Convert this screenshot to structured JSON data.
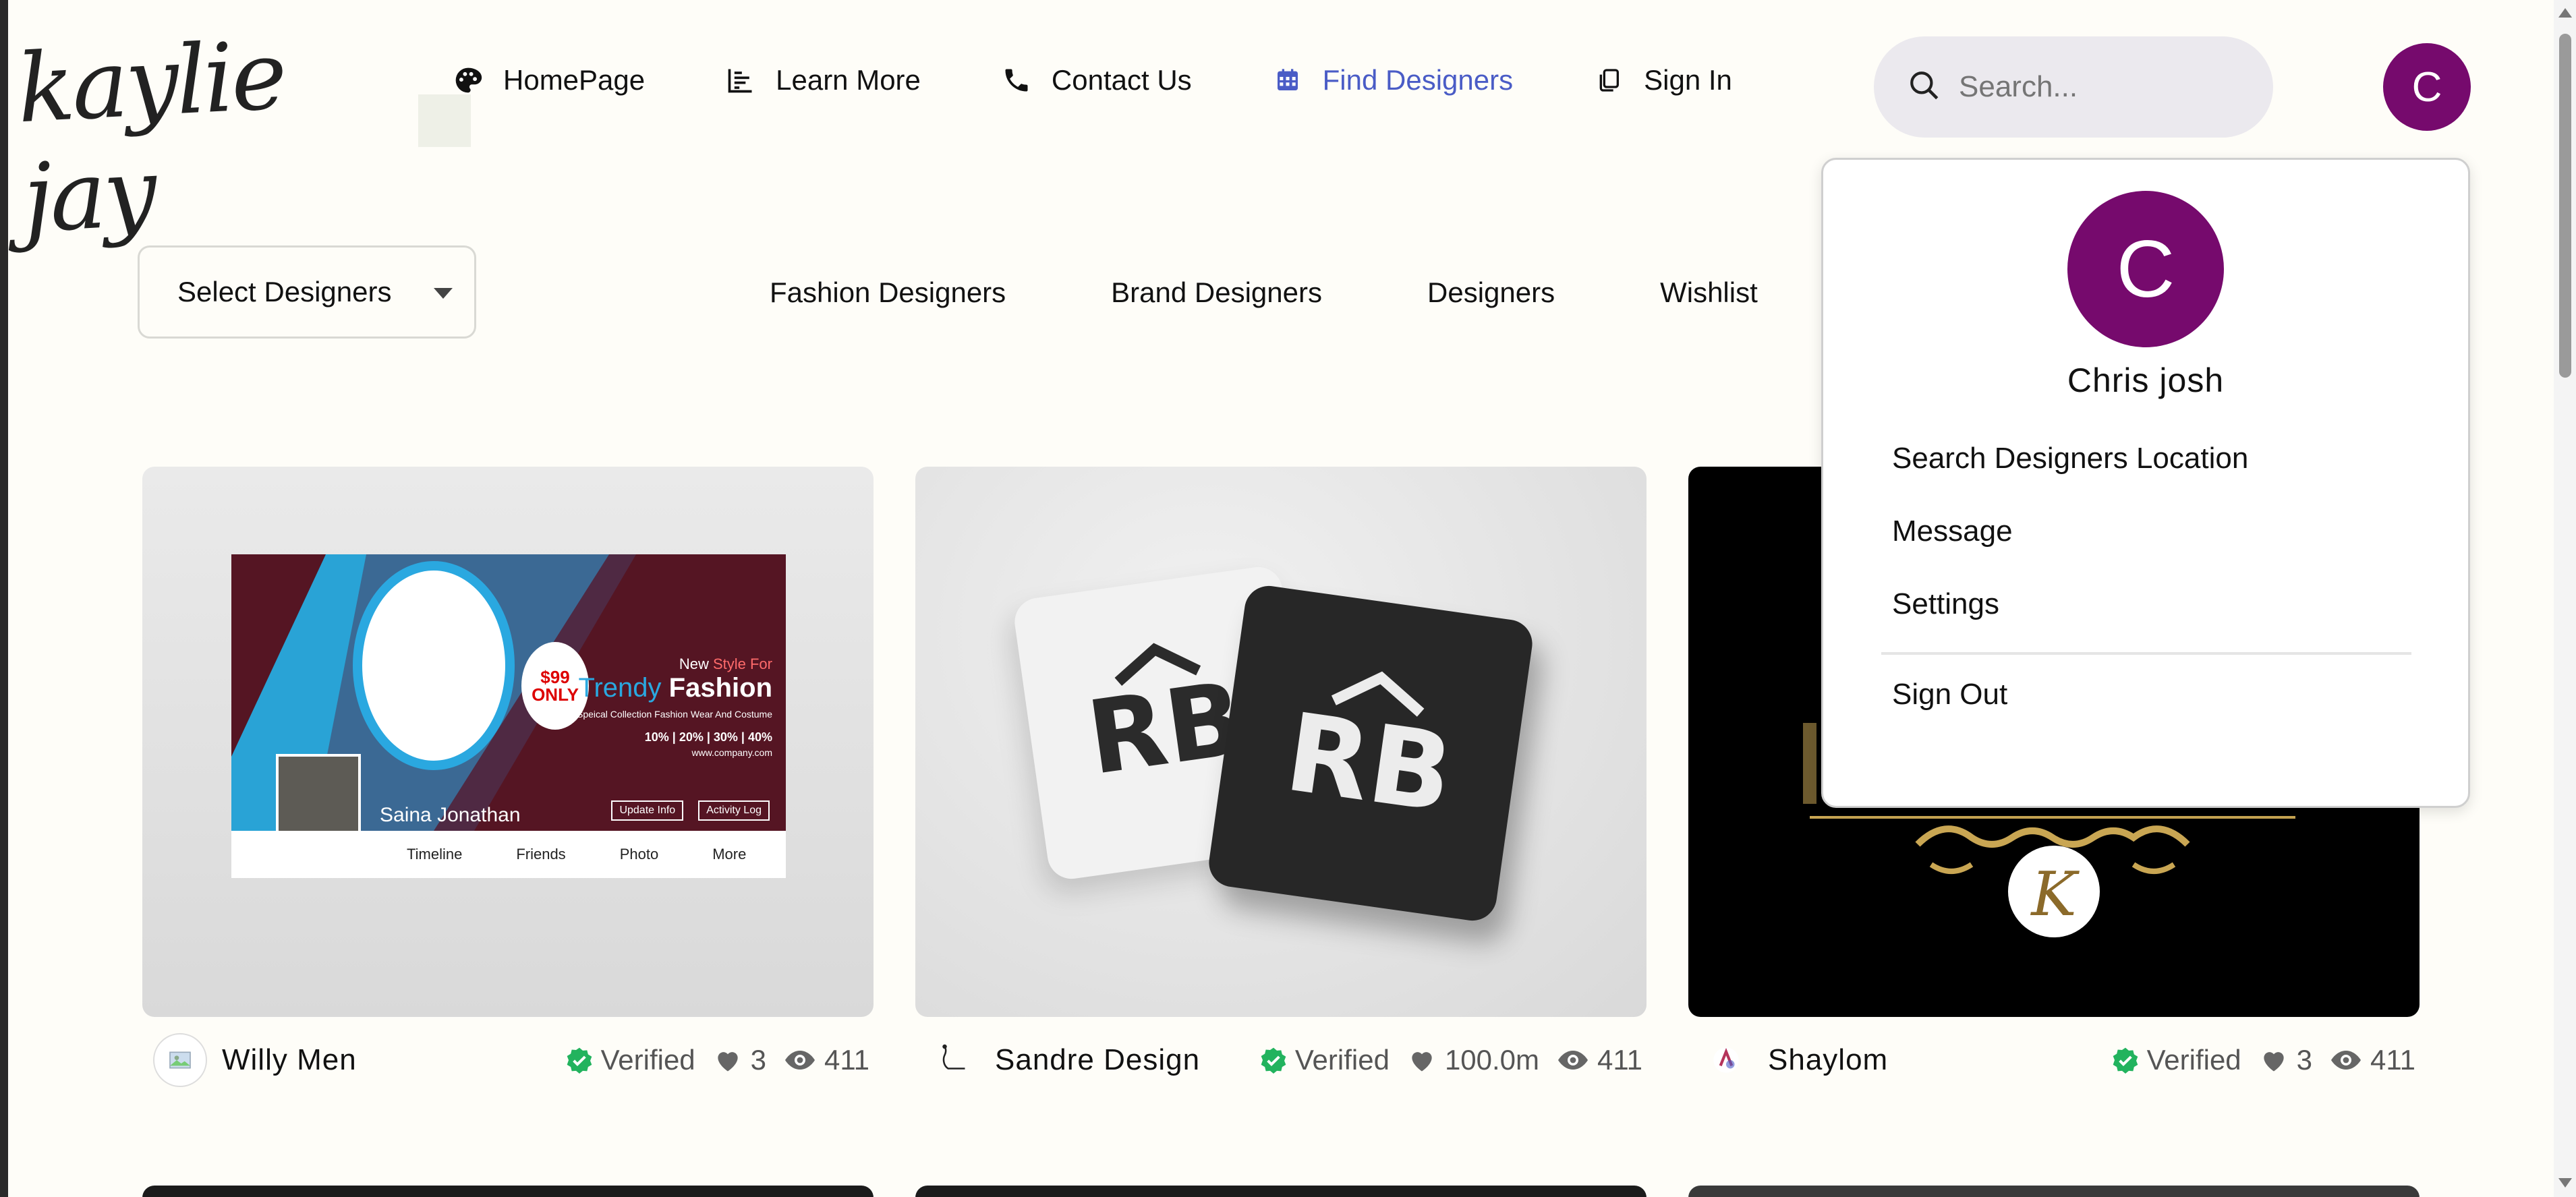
{
  "brand": {
    "logo_text": "kaylie jay"
  },
  "nav": {
    "items": [
      {
        "label": "HomePage",
        "icon": "palette-icon"
      },
      {
        "label": "Learn More",
        "icon": "chart-icon"
      },
      {
        "label": "Contact Us",
        "icon": "phone-icon"
      },
      {
        "label": "Find Designers",
        "icon": "calendar-icon",
        "active": true
      },
      {
        "label": "Sign In",
        "icon": "copy-icon"
      }
    ]
  },
  "search": {
    "placeholder": "Search..."
  },
  "user": {
    "initial": "C",
    "name": "Chris josh",
    "avatar_color": "#760a6d"
  },
  "filters": {
    "select_label": "Select Designers",
    "links": [
      "Fashion Designers",
      "Brand Designers",
      "Designers",
      "Wishlist"
    ]
  },
  "dropdown": {
    "items": [
      "Search Designers Location",
      "Message",
      "Settings"
    ],
    "sign_out": "Sign Out"
  },
  "cards": [
    {
      "name": "Willy Men",
      "verified": "Verified",
      "likes": "3",
      "views": "411",
      "banner": {
        "person": "Saina Jonathan",
        "price": "$99 ONLY",
        "tagline_a": "New ",
        "tagline_b": "Style For",
        "title_a": "Trendy ",
        "title_b": "Fashion",
        "sub": "Spеical Collection Fashion Wear And Costume",
        "discounts": "10% | 20% | 30% | 40%",
        "site": "www.company.com",
        "btn1": "Update Info",
        "btn2": "Activity Log",
        "tabs": [
          "Timeline",
          "Friends",
          "Photo",
          "More"
        ]
      }
    },
    {
      "name": "Sandre Design",
      "verified": "Verified",
      "likes": "100.0m",
      "views": "411",
      "mark": "RB"
    },
    {
      "name": "Shaylom",
      "verified": "Verified",
      "likes": "3",
      "views": "411",
      "mark": "K"
    }
  ],
  "colors": {
    "accent": "#4a5cc6",
    "verified": "#22b35e",
    "background": "#fefdf8"
  }
}
